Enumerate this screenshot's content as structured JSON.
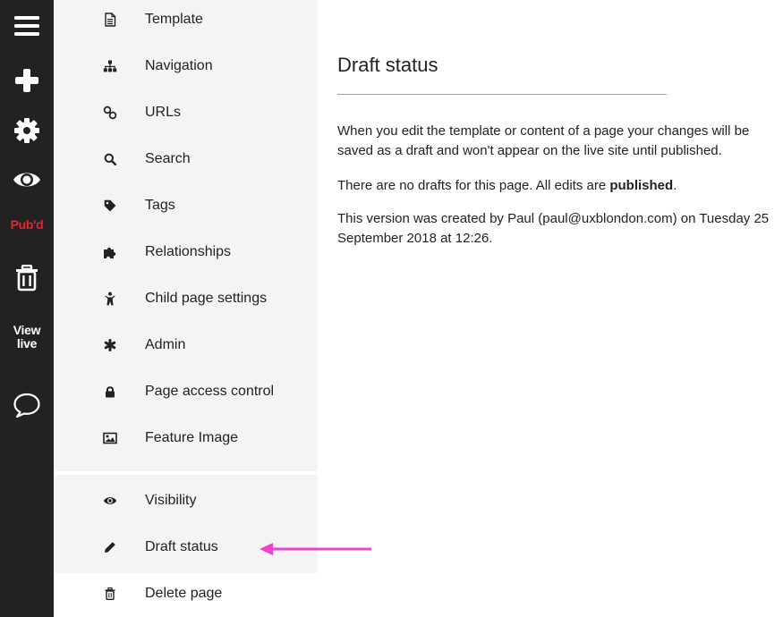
{
  "rail": {
    "published_label": "Pub'd",
    "view_live_line1": "View",
    "view_live_line2": "live",
    "published_color": "#e8262b",
    "icons": [
      "menu-icon",
      "add-icon",
      "gear-icon",
      "eye-icon",
      "trash-icon",
      "comment-icon"
    ]
  },
  "menu": {
    "items": [
      {
        "label": "Template",
        "icon": "document-icon"
      },
      {
        "label": "Navigation",
        "icon": "sitemap-icon"
      },
      {
        "label": "URLs",
        "icon": "link-icon"
      },
      {
        "label": "Search",
        "icon": "search-icon"
      },
      {
        "label": "Tags",
        "icon": "tag-icon"
      },
      {
        "label": "Relationships",
        "icon": "puzzle-icon"
      },
      {
        "label": "Child page settings",
        "icon": "child-icon"
      },
      {
        "label": "Admin",
        "icon": "asterisk-icon"
      },
      {
        "label": "Page access control",
        "icon": "lock-icon"
      },
      {
        "label": "Feature Image",
        "icon": "image-icon"
      }
    ],
    "secondary": [
      {
        "label": "Visibility",
        "icon": "eye-icon"
      },
      {
        "label": "Draft status",
        "icon": "pencil-icon"
      },
      {
        "label": "Delete page",
        "icon": "trash-icon"
      }
    ]
  },
  "content": {
    "title": "Draft status",
    "para1": "When you edit the template or content of a page your changes will be saved as a draft and won't appear on the live site until published.",
    "para2_before": "There are no drafts for this page. All edits are ",
    "para2_bold": "published",
    "para2_after": ".",
    "para3": "This version was created by Paul (paul@uxblondon.com) on Tuesday 25 September 2018 at 12:26.",
    "divider_color": "#f08080"
  },
  "annotation": {
    "arrow_color": "#ee44cc"
  }
}
